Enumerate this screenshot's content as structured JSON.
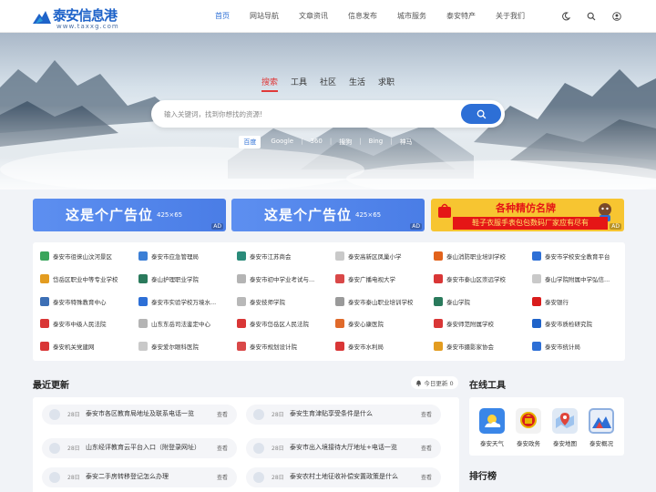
{
  "header": {
    "logo_name": "泰安信息港",
    "logo_url": "www.taxxg.com",
    "nav": [
      "首页",
      "网站导航",
      "文章资讯",
      "信息发布",
      "城市服务",
      "泰安特产",
      "关于我们"
    ],
    "icons": [
      "moon-icon",
      "search-icon",
      "user-icon"
    ]
  },
  "search": {
    "tabs": [
      "搜索",
      "工具",
      "社区",
      "生活",
      "求职"
    ],
    "active_tab": "搜索",
    "placeholder": "输入关键词，找到你想找的资源!",
    "engines": [
      "百度",
      "Google",
      "360",
      "搜狗",
      "Bing",
      "神马"
    ],
    "active_engine": "百度"
  },
  "ads": {
    "banner_text": "这是个广告位",
    "banner_size": "425×65",
    "ad_tag": "AD",
    "promo_title": "各种精仿名牌",
    "promo_sub": "鞋子衣服手表包包数码厂家应有尽有"
  },
  "links": [
    [
      "泰安市徂徕山汶河景区",
      "泰安市应急管理局",
      "泰安市江苏商会",
      "泰安高新区凤巢小学",
      "泰山消防职业培训学校",
      "泰安市学校安全教育平台"
    ],
    [
      "岱岳区职业中等专业学校",
      "泰山护理职业学院",
      "泰安市初中学业考试与...",
      "泰安广播电视大学",
      "泰安市泰山区崇远学校",
      "泰山学院附属中学弘信..."
    ],
    [
      "泰安市特殊教育中心",
      "泰安市实验学校万境水...",
      "泰安技师学院",
      "泰安市泰山职业培训学校",
      "泰山学院",
      "泰安银行"
    ],
    [
      "泰安市中级人民法院",
      "山东东岳司法鉴定中心",
      "泰安市岱岳区人民法院",
      "泰安心康医院",
      "泰安师范附属学校",
      "泰安市质检研究院"
    ],
    [
      "泰安机关党建网",
      "泰安爱尔眼科医院",
      "泰安市规划设计院",
      "泰安市水利局",
      "泰安市摄影家协会",
      "泰安市统计局"
    ]
  ],
  "link_colors": [
    [
      "#3aa55b",
      "#3c7fd6",
      "#2a8b7a",
      "#c9c9c9",
      "#e2621b",
      "#2d6fd6"
    ],
    [
      "#e39c20",
      "#2a7a5c",
      "#b4b4b4",
      "#d94848",
      "#d93636",
      "#c9c9c9"
    ],
    [
      "#3c6fb5",
      "#2d6fd6",
      "#b8b8b8",
      "#9a9a9a",
      "#2a7a5c",
      "#d91c1c"
    ],
    [
      "#d93636",
      "#b4b4b4",
      "#d93636",
      "#e06a2a",
      "#d93636",
      "#1f63c9"
    ],
    [
      "#d93636",
      "#c9c9c9",
      "#d94848",
      "#d93636",
      "#e39c20",
      "#2d6fd6"
    ]
  ],
  "recent": {
    "title": "最近更新",
    "today_label": "今日更新 0",
    "view_label": "查看",
    "items": [
      {
        "date": "28日",
        "title": "泰安市各区教育局地址及联系电话一览"
      },
      {
        "date": "28日",
        "title": "泰安生育津贴享受条件是什么"
      },
      {
        "date": "28日",
        "title": "山东经评教育云平台入口（附登录网址）"
      },
      {
        "date": "28日",
        "title": "泰安市出入境接待大厅地址+电话一览"
      },
      {
        "date": "28日",
        "title": "泰安二手房转移登记怎么办理"
      },
      {
        "date": "28日",
        "title": "泰安农村土地征收补偿安置政策是什么"
      }
    ]
  },
  "tools": {
    "title": "在线工具",
    "items": [
      {
        "label": "泰安天气",
        "icon": "weather-icon",
        "color": "#3a86e8"
      },
      {
        "label": "泰安政务",
        "icon": "government-emblem-icon",
        "color": "#f2f2f2"
      },
      {
        "label": "泰安地图",
        "icon": "map-icon",
        "color": "#dfe9f5"
      },
      {
        "label": "泰安概况",
        "icon": "mountain-icon",
        "color": "#8fb0e0"
      }
    ]
  },
  "ranking": {
    "title": "排行榜"
  },
  "colors": {
    "primary": "#2d6fd6",
    "active_tab": "#e03a3a",
    "promo_bg": "#f7c531",
    "promo_red": "#e51616"
  }
}
